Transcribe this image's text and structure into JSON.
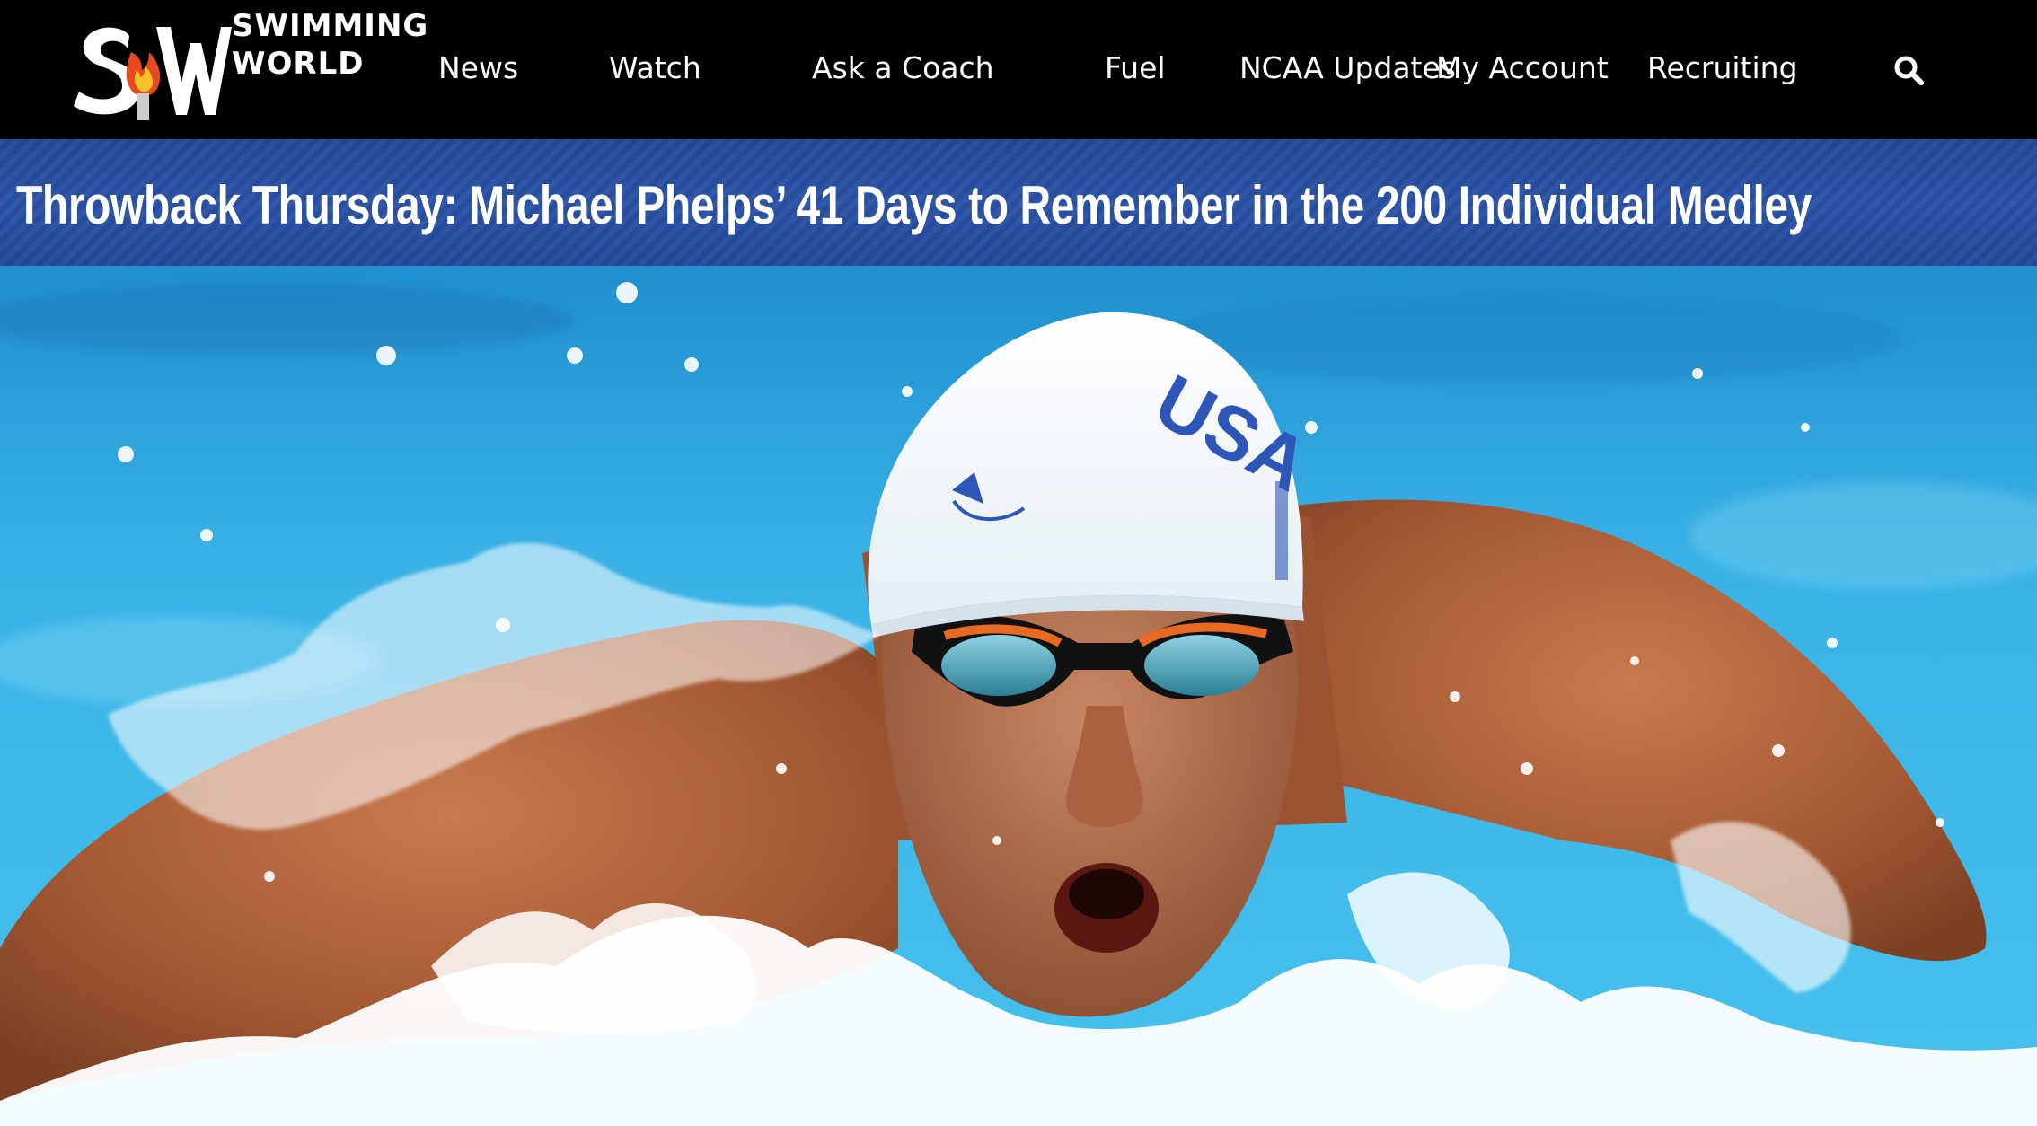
{
  "logo": {
    "line1": "SWIMMING",
    "line2": "WORLD"
  },
  "nav": {
    "items": [
      "News",
      "Watch",
      "Ask a Coach",
      "Fuel",
      "NCAA Updates",
      "My Account",
      "Recruiting"
    ]
  },
  "article": {
    "title": "Throwback Thursday: Michael Phelps’ 41 Days to Remember in the 200 Individual Medley"
  },
  "hero": {
    "cap_text": "USA"
  },
  "colors": {
    "nav_bg": "#000000",
    "banner_blue": "#2a52a6",
    "water": "#2fa9df"
  },
  "icons": {
    "search": "search-icon",
    "logo_flame": "flame-icon"
  }
}
